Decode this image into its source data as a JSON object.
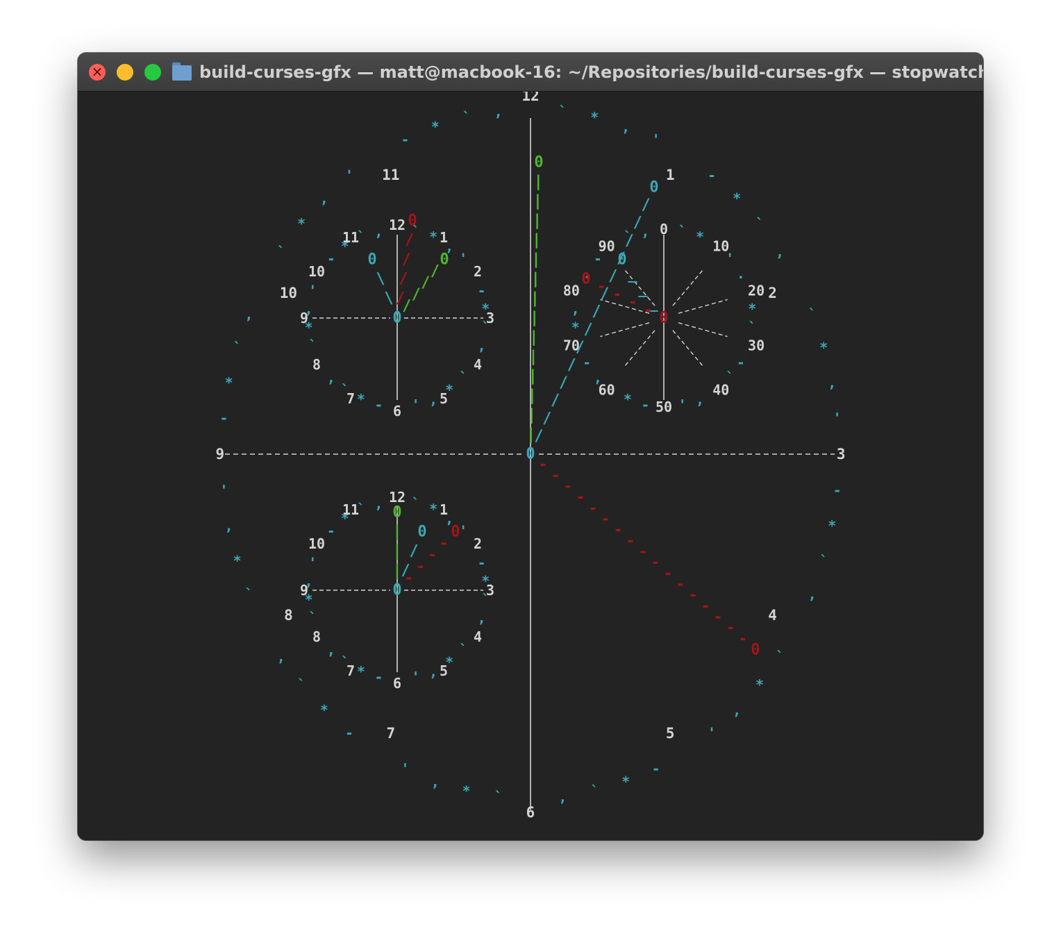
{
  "window": {
    "title": "build-curses-gfx — matt@macbook-16: ~/Repositories/build-curses-gfx — stopwatch..."
  },
  "colors": {
    "background": "#232323",
    "numeral": "#d4d4d4",
    "cyan": "#3aa7b5",
    "green": "#4fb52c",
    "red": "#a3151a",
    "line": "#d4d4d4"
  },
  "clock": {
    "main_numerals": [
      "12",
      "1",
      "2",
      "3",
      "4",
      "5",
      "6",
      "7",
      "8",
      "9",
      "10",
      "11"
    ],
    "small_numerals": [
      "12",
      "1",
      "2",
      "3",
      "4",
      "5",
      "6",
      "7",
      "8",
      "9",
      "10",
      "11"
    ],
    "seconds_labels": [
      "0",
      "10",
      "20",
      "30",
      "40",
      "50",
      "60",
      "70",
      "80",
      "90"
    ],
    "hand_tip": "0"
  }
}
